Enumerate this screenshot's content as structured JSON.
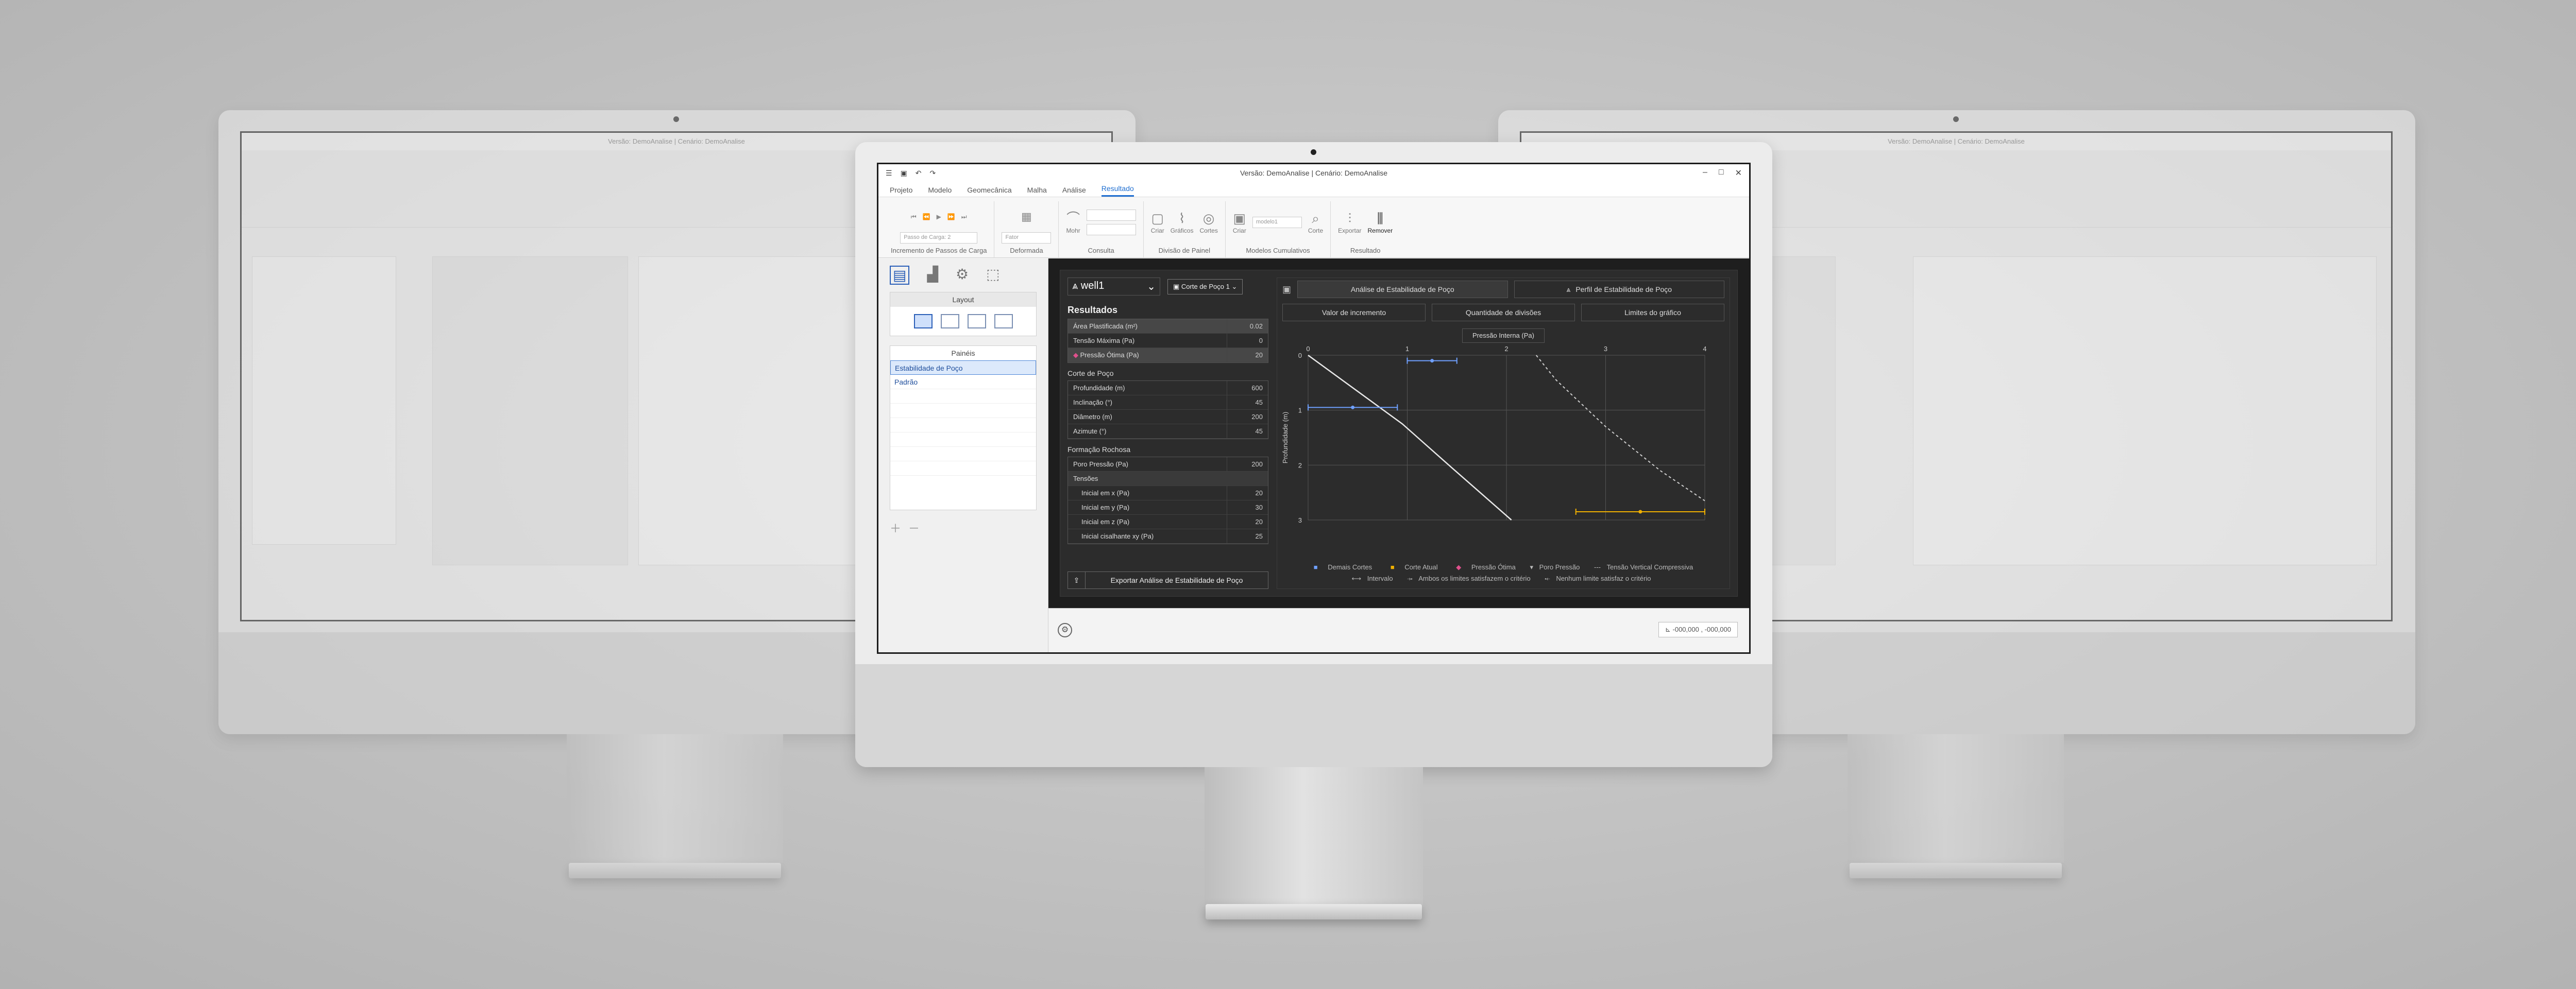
{
  "app": {
    "title": "Versão: DemoAnalise | Cenário: DemoAnalise",
    "tabs": [
      "Projeto",
      "Modelo",
      "Geomecânica",
      "Malha",
      "Análise",
      "Resultado"
    ],
    "active_tab": "Resultado"
  },
  "ribbon": {
    "groups": [
      {
        "label": "Incremento de Passos de Carga",
        "field": "Passo de Carga: 2"
      },
      {
        "label": "Deformada",
        "field": "Fator"
      },
      {
        "label": "Consulta",
        "button": "Mohr"
      },
      {
        "label": "Divisão de Painel",
        "buttons": [
          "Criar",
          "Gráficos",
          "Cortes"
        ]
      },
      {
        "label": "Modelos Cumulativos",
        "buttons": [
          "Criar",
          "Corte"
        ],
        "field": "modelo1"
      },
      {
        "label": "Resultado",
        "buttons": [
          "Exportar",
          "Remover"
        ]
      }
    ]
  },
  "left_panel": {
    "layout_title": "Layout",
    "paineis_title": "Painéis",
    "paineis": [
      "Estabilidade de Poço",
      "Padrão"
    ],
    "selected": "Estabilidade de Poço"
  },
  "results": {
    "well": "well1",
    "corte": "Corte de Poço 1",
    "resultados_title": "Resultados",
    "resultados": [
      {
        "k": "Área Plastificada (m²)",
        "v": "0.02"
      },
      {
        "k": "Tensão Máxima (Pa)",
        "v": "0"
      },
      {
        "k": "Pressão Ótima (Pa)",
        "v": "20"
      }
    ],
    "corte_title": "Corte de Poço",
    "corte_rows": [
      {
        "k": "Profundidade (m)",
        "v": "600"
      },
      {
        "k": "Inclinação (°)",
        "v": "45"
      },
      {
        "k": "Diâmetro (m)",
        "v": "200"
      },
      {
        "k": "Azimute (°)",
        "v": "45"
      }
    ],
    "formacao_title": "Formação Rochosa",
    "poro": {
      "k": "Poro Pressão (Pa)",
      "v": "200"
    },
    "tensoes_title": "Tensões",
    "tensoes": [
      {
        "k": "Inicial em x (Pa)",
        "v": "20"
      },
      {
        "k": "Inicial em y (Pa)",
        "v": "30"
      },
      {
        "k": "Inicial em z (Pa)",
        "v": "20"
      },
      {
        "k": "Inicial cisalhante xy (Pa)",
        "v": "25"
      }
    ],
    "export": "Exportar Análise de Estabilidade de Poço"
  },
  "chart_panel": {
    "tab1": "Análise de Estabilidade de Poço",
    "tab2": "Perfil de Estabilidade de Poço",
    "sub1": "Valor de incremento",
    "sub2": "Quantidade de divisões",
    "sub3": "Limites do gráfico",
    "pill": "Pressão Interna (Pa)",
    "legend1": [
      "Demais Cortes",
      "Corte Atual",
      "Pressão Ótima",
      "Poro Pressão",
      "Tensão Vertical Compressiva"
    ],
    "legend2": [
      "Intervalo",
      "Ambos os limites satisfazem o critério",
      "Nenhum limite satisfaz o critério"
    ]
  },
  "chart_data": {
    "type": "line",
    "xlabel": "",
    "ylabel": "Profundidade (m)",
    "xlim": [
      0,
      4
    ],
    "ylim": [
      0,
      3
    ],
    "xticks": [
      "0",
      "1",
      "2",
      "3",
      "4"
    ],
    "yticks": [
      "0",
      "1",
      "2",
      "3"
    ],
    "series": [
      {
        "name": "Demais Cortes",
        "points": [
          [
            0,
            0
          ],
          [
            0.95,
            1.25
          ],
          [
            1.45,
            2.05
          ],
          [
            2.05,
            3.0
          ]
        ]
      },
      {
        "name": "Tensão Vertical Compressiva",
        "points": [
          [
            2.3,
            0
          ],
          [
            2.5,
            0.45
          ],
          [
            3.0,
            1.3
          ],
          [
            3.55,
            2.1
          ],
          [
            4.0,
            2.65
          ]
        ]
      }
    ],
    "intervals": [
      {
        "y": 0.1,
        "x": [
          1.0,
          1.5
        ]
      },
      {
        "y": 0.95,
        "x": [
          0.0,
          0.9
        ]
      },
      {
        "y": 2.85,
        "x": [
          2.7,
          4.0
        ]
      }
    ]
  },
  "status": {
    "coords": "-000,000 , -000,000"
  }
}
